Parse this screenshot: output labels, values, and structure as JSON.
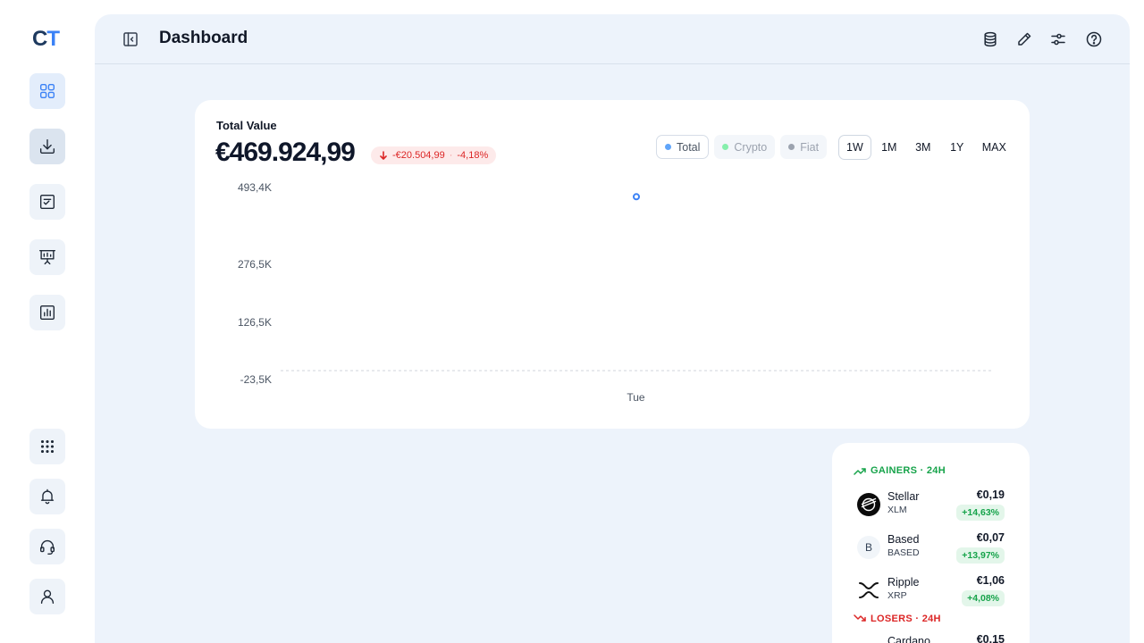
{
  "app": {
    "logo_c": "C",
    "logo_t": "T"
  },
  "header": {
    "title": "Dashboard"
  },
  "icons": {
    "rail": [
      "dashboard-grid-icon",
      "download-icon",
      "checklist-icon",
      "presentation-icon",
      "bar-report-icon",
      "apps-grid-icon",
      "bell-icon",
      "headset-icon",
      "user-icon"
    ],
    "header": [
      "database-icon",
      "pencil-icon",
      "sliders-icon",
      "help-circle-icon"
    ]
  },
  "colors": {
    "accent": "#3b82f6",
    "negative": "#dc2626",
    "positive": "#16a34a",
    "crypto_dot": "#86efac",
    "fiat_dot": "#9ca3af"
  },
  "summary": {
    "label": "Total Value",
    "amount": "€469.924,99",
    "change_abs": "-€20.504,99",
    "change_sep": "·",
    "change_pct": "-4,18%"
  },
  "series_toggles": [
    {
      "label": "Total",
      "active": true
    },
    {
      "label": "Crypto",
      "active": false
    },
    {
      "label": "Fiat",
      "active": false
    }
  ],
  "ranges": [
    {
      "label": "1W",
      "active": true
    },
    {
      "label": "1M",
      "active": false
    },
    {
      "label": "3M",
      "active": false
    },
    {
      "label": "1Y",
      "active": false
    },
    {
      "label": "MAX",
      "active": false
    }
  ],
  "chart_data": {
    "type": "line",
    "x": [
      "Tue"
    ],
    "series": [
      {
        "name": "Total",
        "values": [
          469924.99
        ]
      }
    ],
    "y_ticks": [
      "493,4K",
      "276,5K",
      "126,5K",
      "-23,5K"
    ],
    "y_tick_values": [
      493400,
      276500,
      126500,
      -23500
    ],
    "ylim": [
      -23500,
      493400
    ],
    "zero_line": 0,
    "grid": false
  },
  "gainers": {
    "title": "GAINERS · 24H",
    "items": [
      {
        "name": "Stellar",
        "symbol": "XLM",
        "price": "€0,19",
        "change": "+14,63%",
        "icon": "stellar-icon"
      },
      {
        "name": "Based",
        "symbol": "BASED",
        "price": "€0,07",
        "change": "+13,97%",
        "icon_letter": "B"
      },
      {
        "name": "Ripple",
        "symbol": "XRP",
        "price": "€1,06",
        "change": "+4,08%",
        "icon": "ripple-icon"
      }
    ]
  },
  "losers": {
    "title": "LOSERS · 24H",
    "items": [
      {
        "name": "Cardano",
        "price": "€0,15"
      }
    ]
  }
}
